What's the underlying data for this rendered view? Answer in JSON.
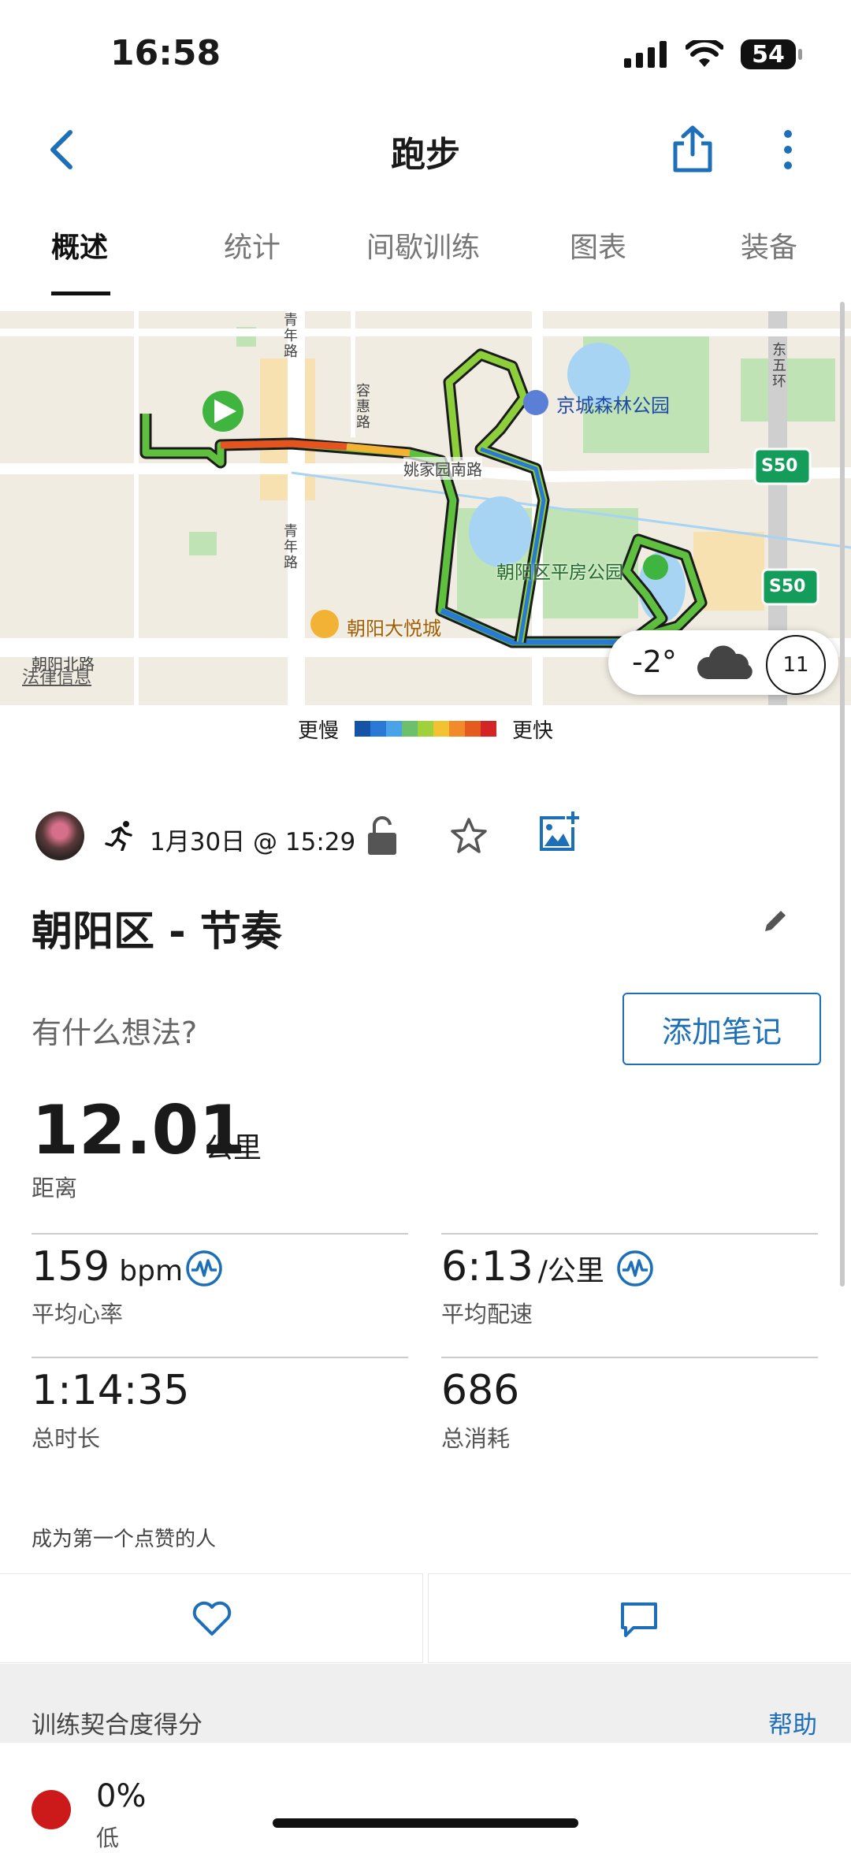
{
  "status_bar": {
    "time": "16:58",
    "battery": "54"
  },
  "nav": {
    "title": "跑步"
  },
  "tabs": [
    {
      "label": "概述",
      "active": true
    },
    {
      "label": "统计",
      "active": false
    },
    {
      "label": "间歇训练",
      "active": false
    },
    {
      "label": "图表",
      "active": false
    },
    {
      "label": "装备",
      "active": false
    }
  ],
  "map": {
    "labels": {
      "jingcheng_park": "京城森林公园",
      "yaojiayuan_road": "姚家园南路",
      "pingfang_park": "朝阳区平房公园",
      "mall": "朝阳大悦城",
      "chaoyang_north_road": "朝阳北路",
      "qingnian_road_1": "青年路",
      "qingnian_road_2": "青年路",
      "ronghui_road": "容惠路",
      "east_fifth_ring": "东五环",
      "s50_1": "S50",
      "s50_2": "S50"
    },
    "legal": "法律信息",
    "weather": {
      "temp": "-2°",
      "wind": "11"
    },
    "legend": {
      "slower": "更慢",
      "faster": "更快",
      "colors": [
        "#1553a6",
        "#2a79d6",
        "#4aa3e8",
        "#6cc06c",
        "#9ed13b",
        "#f2c233",
        "#f08a2a",
        "#e55a1f",
        "#d32525"
      ]
    }
  },
  "activity": {
    "date": "1月30日 @ 15:29",
    "title": "朝阳区 - 节奏",
    "thoughts_prompt": "有什么想法?",
    "add_note": "添加笔记",
    "distance": {
      "value": "12.01",
      "unit": "公里",
      "label": "距离"
    },
    "heart_rate": {
      "value": "159",
      "unit": "bpm",
      "label": "平均心率"
    },
    "pace": {
      "value": "6:13",
      "unit": "/公里",
      "label": "平均配速"
    },
    "duration": {
      "value": "1:14:35",
      "label": "总时长"
    },
    "calories": {
      "value": "686",
      "label": "总消耗"
    },
    "likes_text": "成为第一个点赞的人"
  },
  "score": {
    "title": "训练契合度得分",
    "help": "帮助",
    "value": "0%",
    "level": "低",
    "dot_color": "#cc1a1a"
  }
}
